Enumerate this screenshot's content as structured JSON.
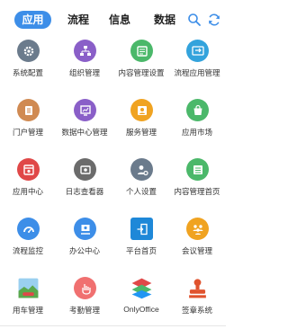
{
  "tabs": [
    {
      "label": "应用",
      "active": true
    },
    {
      "label": "流程",
      "active": false
    },
    {
      "label": "信息",
      "active": false
    },
    {
      "label": "数据",
      "active": false
    }
  ],
  "toolbar": {
    "search_icon": "search-icon",
    "refresh_icon": "refresh-icon",
    "accent": "#3d8ee8"
  },
  "apps": [
    {
      "label": "系统配置",
      "icon": "gear-icon",
      "color": "#6b7b8c"
    },
    {
      "label": "组织管理",
      "icon": "org-chart-icon",
      "color": "#8a5fc8"
    },
    {
      "label": "内容管理设置",
      "icon": "content-settings-icon",
      "color": "#4bb86a"
    },
    {
      "label": "流程应用管理",
      "icon": "workflow-app-icon",
      "color": "#33a3dc"
    },
    {
      "label": "门户管理",
      "icon": "portal-icon",
      "color": "#d08a52"
    },
    {
      "label": "数据中心管理",
      "icon": "data-center-icon",
      "color": "#8a5fc8"
    },
    {
      "label": "服务管理",
      "icon": "service-icon",
      "color": "#f0a321"
    },
    {
      "label": "应用市场",
      "icon": "shopping-bag-icon",
      "color": "#4bb86a"
    },
    {
      "label": "应用中心",
      "icon": "app-center-icon",
      "color": "#e04848"
    },
    {
      "label": "日志查看器",
      "icon": "log-viewer-icon",
      "color": "#6b6b6b"
    },
    {
      "label": "个人设置",
      "icon": "user-settings-icon",
      "color": "#6b7b8c"
    },
    {
      "label": "内容管理首页",
      "icon": "content-home-icon",
      "color": "#4bb86a"
    },
    {
      "label": "流程监控",
      "icon": "gauge-icon",
      "color": "#3d8ee8"
    },
    {
      "label": "办公中心",
      "icon": "office-icon",
      "color": "#3d8ee8"
    },
    {
      "label": "平台首页",
      "icon": "exit-door-icon",
      "color": "#1e88d8"
    },
    {
      "label": "会议管理",
      "icon": "meeting-icon",
      "color": "#f0a321"
    },
    {
      "label": "用车管理",
      "icon": "car-landscape-icon",
      "color": "#5fb0e0"
    },
    {
      "label": "考勤管理",
      "icon": "hand-tap-icon",
      "color": "#f07070"
    },
    {
      "label": "OnlyOffice",
      "icon": "onlyoffice-icon",
      "color": "#4bb86a"
    },
    {
      "label": "签章系统",
      "icon": "stamp-icon",
      "color": "#e0532e"
    }
  ]
}
